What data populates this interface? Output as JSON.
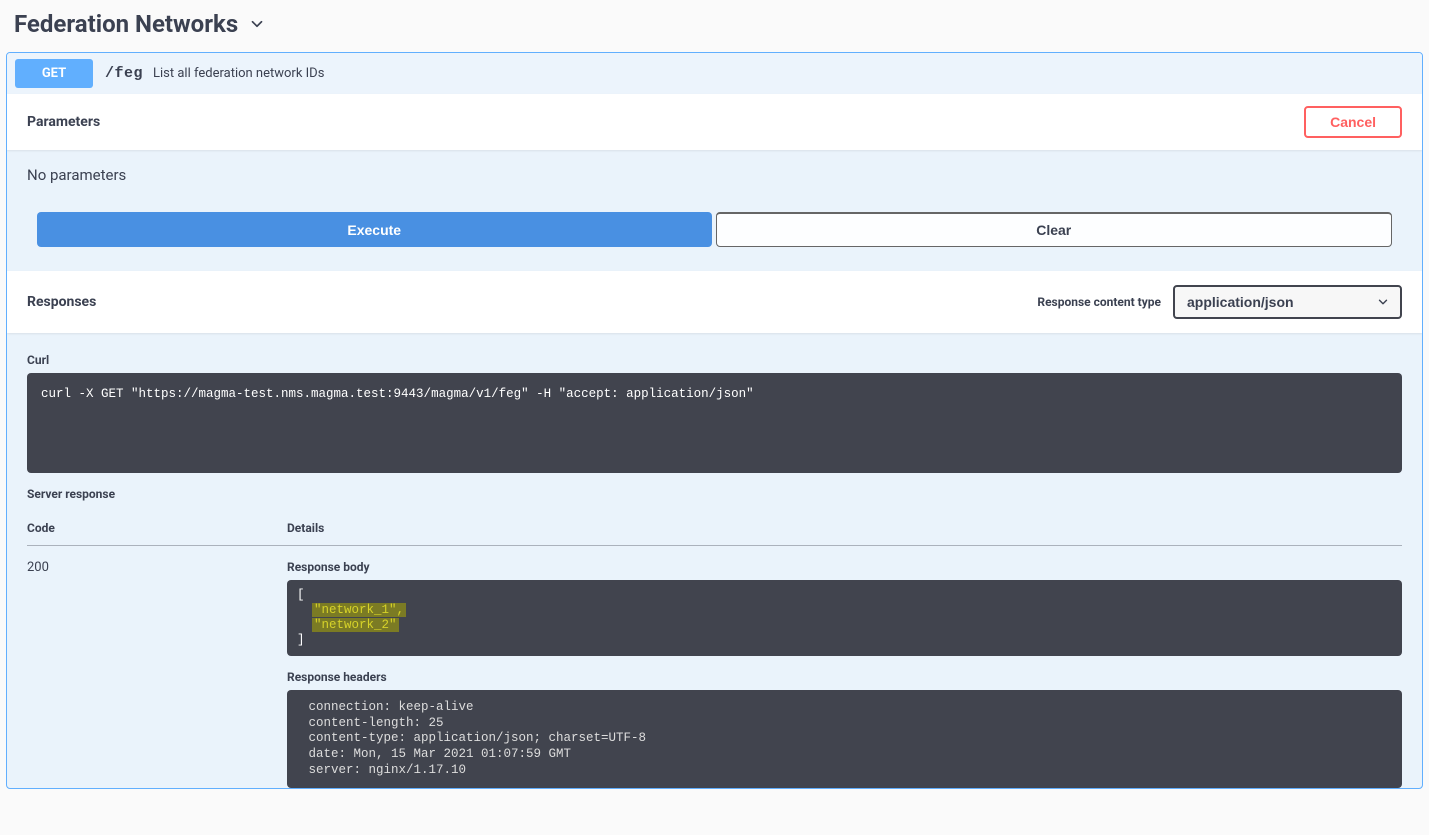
{
  "section": {
    "title": "Federation Networks"
  },
  "op": {
    "method": "GET",
    "path": "/feg",
    "summary": "List all federation network IDs"
  },
  "parameters": {
    "header": "Parameters",
    "cancel": "Cancel",
    "none_text": "No parameters",
    "execute": "Execute",
    "clear": "Clear"
  },
  "responses": {
    "header": "Responses",
    "content_type_label": "Response content type",
    "content_type_value": "application/json",
    "curl_label": "Curl",
    "curl_command": "curl -X GET \"https://magma-test.nms.magma.test:9443/magma/v1/feg\" -H \"accept: application/json\"",
    "server_response_label": "Server response",
    "code_header": "Code",
    "details_header": "Details",
    "code_value": "200",
    "body_label": "Response body",
    "body_value": "[\n  \"network_1\",\n  \"network_2\"\n]",
    "body_items": [
      "network_1",
      "network_2"
    ],
    "headers_label": "Response headers",
    "headers_value": " connection: keep-alive \n content-length: 25 \n content-type: application/json; charset=UTF-8 \n date: Mon, 15 Mar 2021 01:07:59 GMT \n server: nginx/1.17.10 "
  }
}
